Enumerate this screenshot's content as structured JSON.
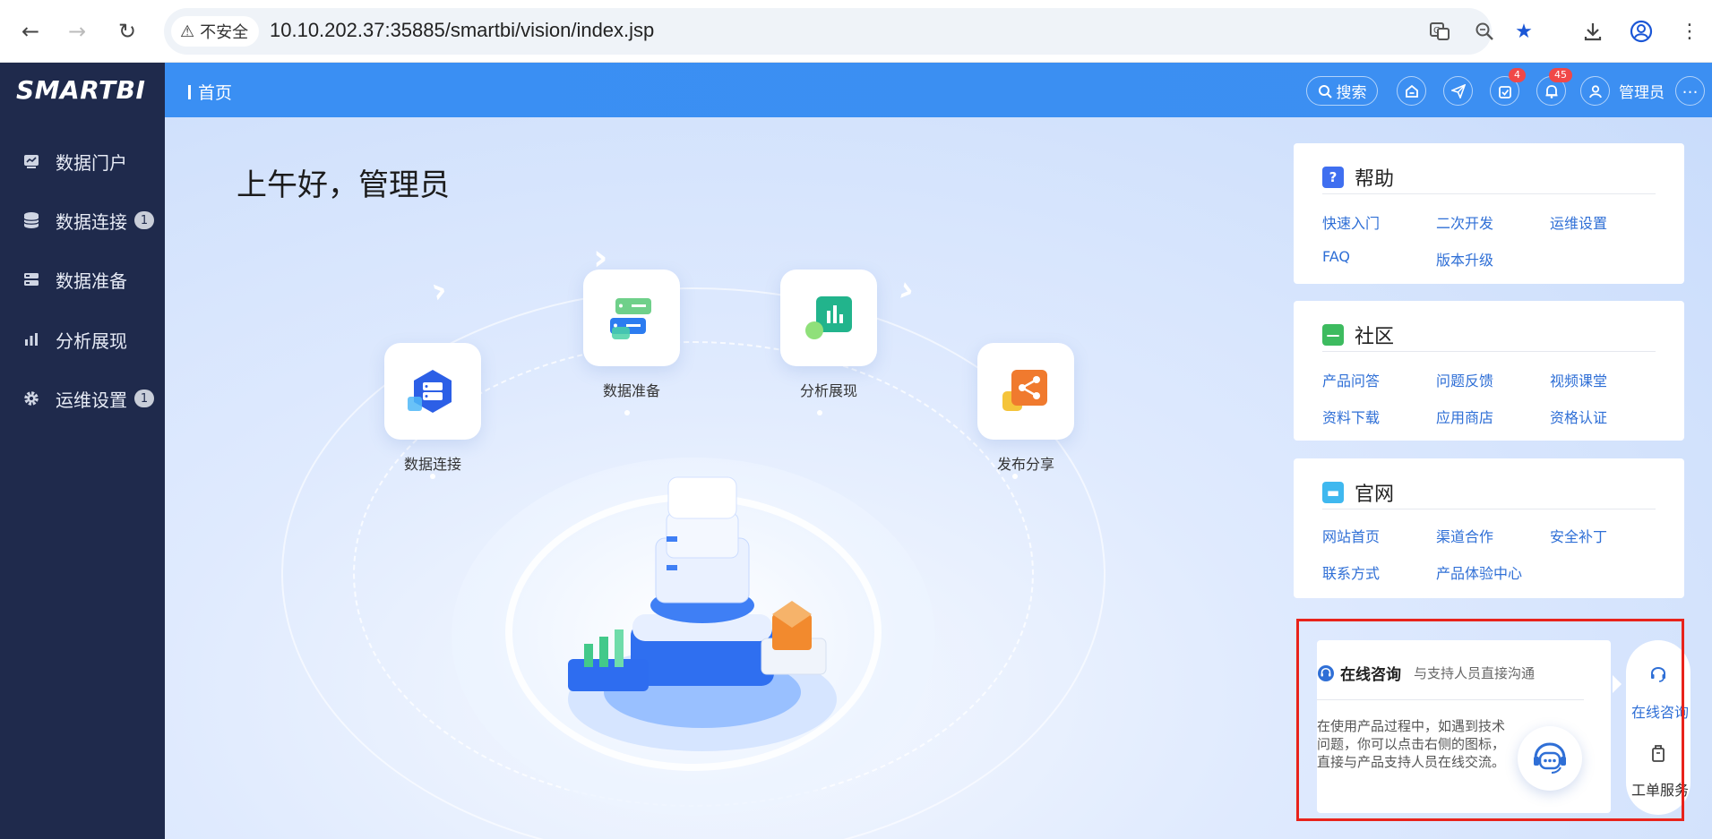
{
  "browser": {
    "security_label": "不安全",
    "url": "10.10.202.37:35885/smartbi/vision/index.jsp"
  },
  "app": {
    "logo": "SMARTBI",
    "breadcrumb": "首页"
  },
  "sidebar": {
    "items": [
      {
        "label": "数据门户",
        "icon": "chart-icon",
        "badge": ""
      },
      {
        "label": "数据连接",
        "icon": "database-icon",
        "badge": "1"
      },
      {
        "label": "数据准备",
        "icon": "server-icon",
        "badge": ""
      },
      {
        "label": "分析展现",
        "icon": "bar-chart-icon",
        "badge": ""
      },
      {
        "label": "运维设置",
        "icon": "gear-icon",
        "badge": "1"
      }
    ]
  },
  "topbar": {
    "search_label": "搜索",
    "tasks_badge": "4",
    "notifications_badge": "45",
    "user_label": "管理员"
  },
  "main": {
    "greeting": "上午好，管理员",
    "flow": [
      {
        "label": "数据连接"
      },
      {
        "label": "数据准备"
      },
      {
        "label": "分析展现"
      },
      {
        "label": "发布分享"
      }
    ]
  },
  "help": {
    "title": "帮助",
    "links": [
      "快速入门",
      "二次开发",
      "运维设置",
      "FAQ",
      "版本升级"
    ]
  },
  "community": {
    "title": "社区",
    "links": [
      "产品问答",
      "问题反馈",
      "视频课堂",
      "资料下载",
      "应用商店",
      "资格认证"
    ]
  },
  "official": {
    "title": "官网",
    "links": [
      "网站首页",
      "渠道合作",
      "安全补丁",
      "联系方式",
      "产品体验中心"
    ]
  },
  "consult": {
    "title": "在线咨询",
    "subtitle": "与支持人员直接沟通",
    "body": "在使用产品过程中，如遇到技术问题，你可以点击右侧的图标，直接与产品支持人员在线交流。",
    "side_online": "在线咨询",
    "side_ticket": "工单服务"
  },
  "colors": {
    "sidebar_bg": "#1f2a4c",
    "topbar_bg": "#3b8ef0",
    "link": "#2f6fd6",
    "highlight_frame": "#e8231b"
  }
}
